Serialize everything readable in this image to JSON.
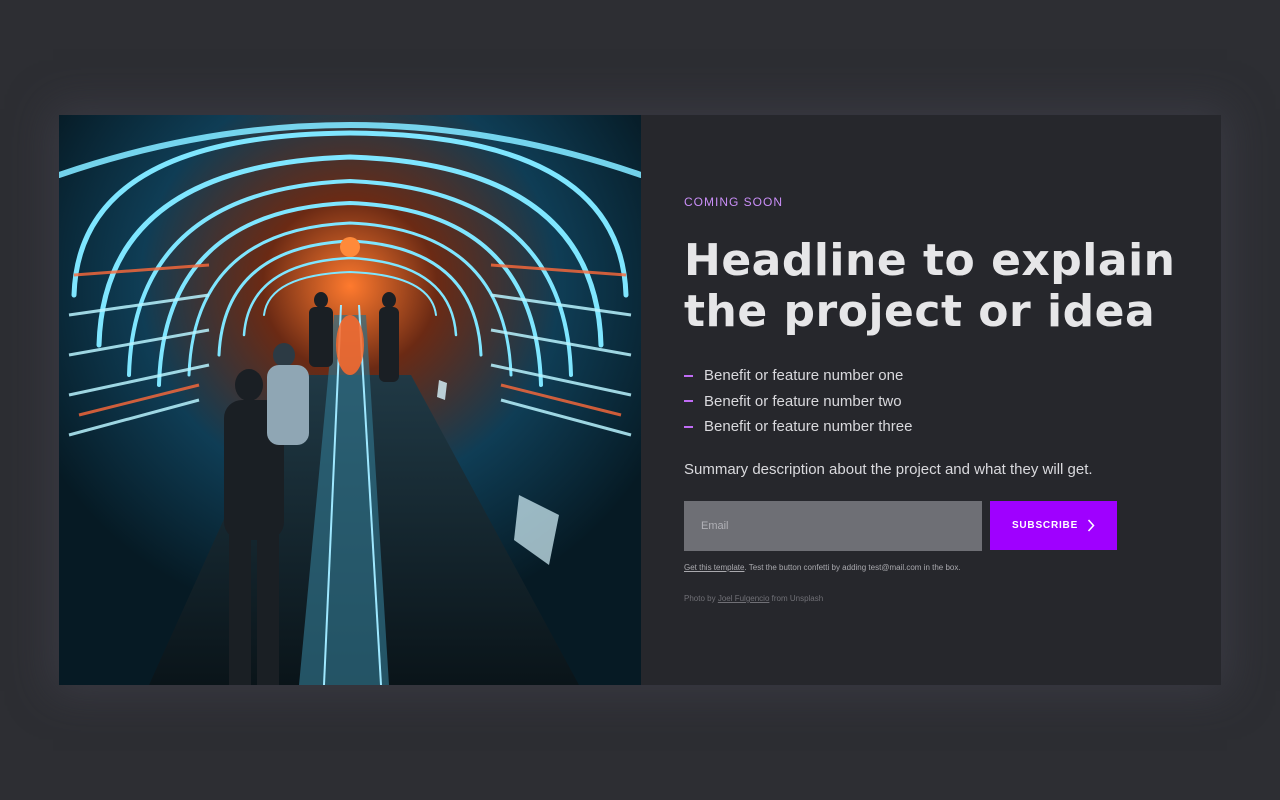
{
  "hero": {
    "image_alt": "people riding an escalator through a neon-lit tunnel"
  },
  "content": {
    "eyebrow": "COMING SOON",
    "headline_line1": "Headline to explain",
    "headline_line2": "the project or idea",
    "benefits": [
      "Benefit or feature number one",
      "Benefit or feature number two",
      "Benefit or feature number three"
    ],
    "summary": "Summary description about the project and what they will get."
  },
  "form": {
    "email_placeholder": "Email",
    "email_value": "",
    "subscribe_label": "SUBSCRIBE"
  },
  "note": {
    "link": "Get this template",
    "text": ". Test the button confetti by adding test@mail.com in the box."
  },
  "credit": {
    "prefix": "Photo by ",
    "author": "Joel Fulgencio",
    "suffix": " from Unsplash"
  },
  "colors": {
    "page_bg": "#2d2e33",
    "card_bg": "#26272c",
    "accent": "#9f00ff",
    "eyebrow": "#c98ef7"
  }
}
